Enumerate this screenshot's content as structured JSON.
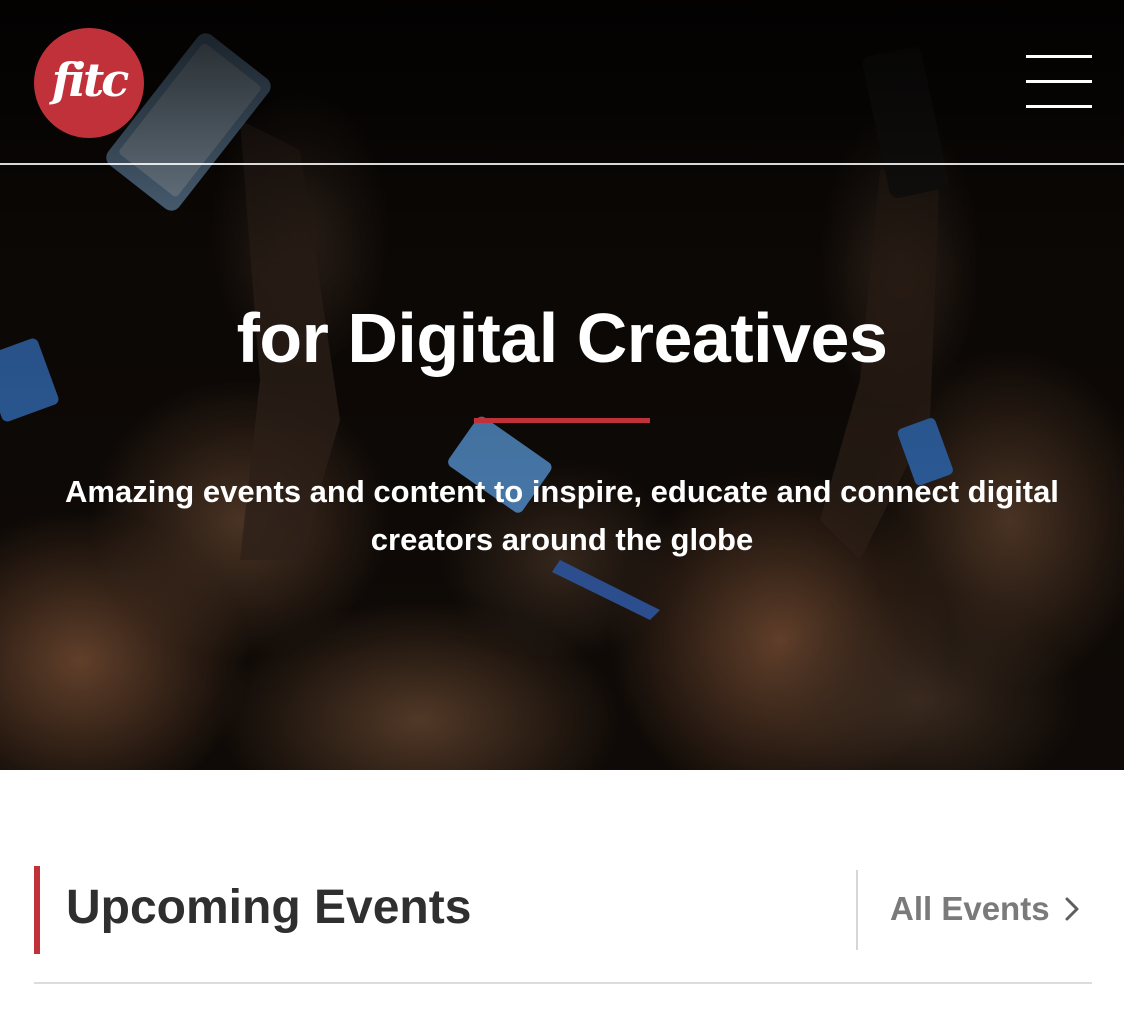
{
  "header": {
    "logo_text": "fitc",
    "menu_icon": "hamburger-menu-icon"
  },
  "hero": {
    "title": "for Digital Creatives",
    "subtitle": "Amazing events and content to inspire, educate and connect digital creators around the globe"
  },
  "upcoming": {
    "title": "Upcoming Events",
    "all_events_label": "All Events",
    "chevron_icon": "chevron-right-icon"
  },
  "colors": {
    "brand_red": "#c1313a",
    "heading_text": "#2f2f2f",
    "link_gray": "#7a7a7a",
    "hero_text": "#ffffff"
  }
}
